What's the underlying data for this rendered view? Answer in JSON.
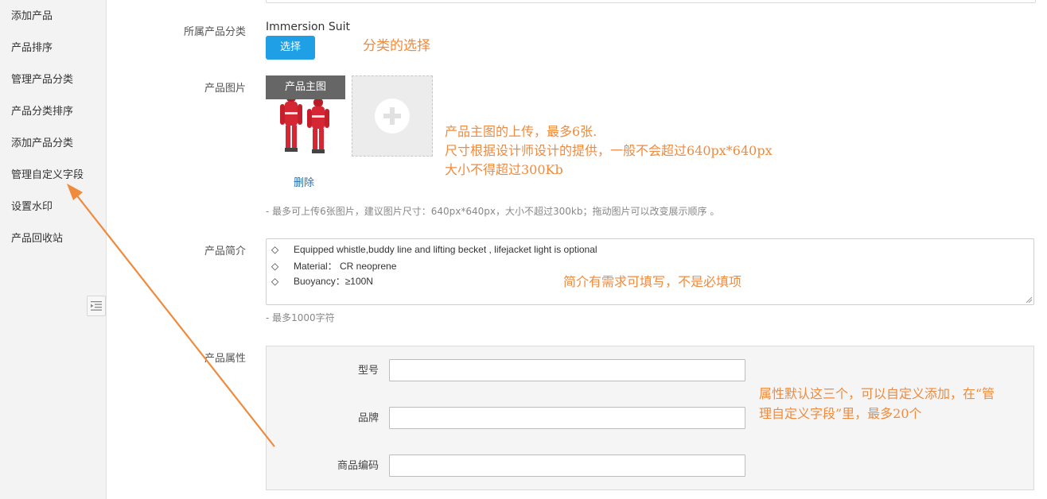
{
  "sidebar": {
    "items": [
      {
        "label": "添加产品"
      },
      {
        "label": "产品排序"
      },
      {
        "label": "管理产品分类"
      },
      {
        "label": "产品分类排序"
      },
      {
        "label": "添加产品分类"
      },
      {
        "label": "管理自定义字段"
      },
      {
        "label": "设置水印"
      },
      {
        "label": "产品回收站"
      }
    ],
    "collapse_icon": "outdent-icon"
  },
  "form": {
    "category": {
      "label": "所属产品分类",
      "value": "Immersion Suit",
      "button": "选择",
      "note": "分类的选择"
    },
    "images": {
      "label": "产品图片",
      "badge": "产品主图",
      "delete": "删除",
      "upload_icon": "plus-icon",
      "hint": "- 最多可上传6张图片，建议图片尺寸：640px*640px，大小不超过300kb；拖动图片可以改变展示顺序 。",
      "note_lines": [
        "产品主图的上传，最多6张.",
        "尺寸根据设计师设计的提供，一般不会超过640px*640px",
        "大小不得超过300Kb"
      ]
    },
    "intro": {
      "label": "产品简介",
      "lines": [
        {
          "bullet": "◇",
          "text": "Equipped whistle,buddy line and lifting becket , lifejacket light is  optional"
        },
        {
          "bullet": "◇",
          "text": "Material：  CR neoprene"
        },
        {
          "bullet": "◇",
          "text": "Buoyancy：≥100N"
        }
      ],
      "hint": "- 最多1000字符",
      "note": "简介有需求可填写，不是必填项"
    },
    "attributes": {
      "label": "产品属性",
      "fields": [
        {
          "label": "型号",
          "value": ""
        },
        {
          "label": "品牌",
          "value": ""
        },
        {
          "label": "商品编码",
          "value": ""
        }
      ],
      "note_lines": [
        "属性默认这三个，可以自定义添加，在“管",
        "理自定义字段”里，最多20个"
      ]
    }
  },
  "colors": {
    "accent": "#1e9fe6",
    "annotation": "#f08a3c",
    "link": "#2a6fb6"
  }
}
